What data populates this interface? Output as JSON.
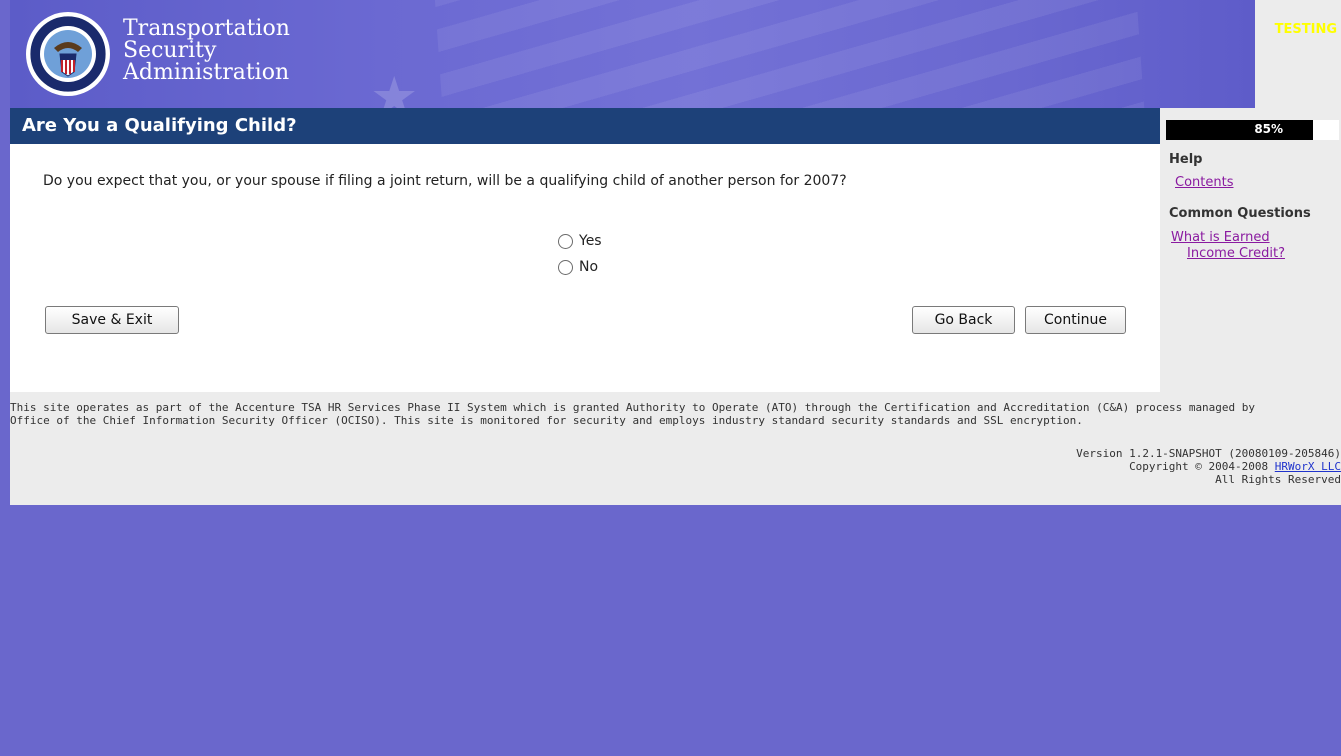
{
  "header": {
    "agency_line1": "Transportation",
    "agency_line2": "Security",
    "agency_line3": "Administration",
    "testing_label": "TESTING"
  },
  "title_bar": {
    "title": "Are You a Qualifying Child?",
    "progress_percent": 85,
    "progress_label": "85%"
  },
  "question": {
    "text": "Do you expect that you, or your spouse if filing a joint return, will be a qualifying child of another person for 2007?",
    "options": [
      "Yes",
      "No"
    ],
    "selected": null
  },
  "buttons": {
    "save_exit": "Save & Exit",
    "go_back": "Go Back",
    "continue": "Continue"
  },
  "help": {
    "heading": "Help",
    "contents_link": "Contents",
    "common_questions_heading": "Common Questions",
    "faq_link_line1": "What is Earned",
    "faq_link_line2": "Income Credit?"
  },
  "footer": {
    "note_line1": "This site operates as part of the Accenture TSA HR Services Phase II System which is granted Authority to Operate (ATO) through the Certification and Accreditation (C&A) process managed by",
    "note_line2": "Office of the Chief Information Security Officer (OCISO). This site is monitored for security and employs industry standard security standards and SSL encryption.",
    "version": "Version 1.2.1-SNAPSHOT (20080109-205846)",
    "copyright_prefix": "Copyright © 2004-2008 ",
    "copyright_link": "HRWorX LLC",
    "rights": "All Rights Reserved"
  },
  "colors": {
    "page_background": "#6a67cc",
    "title_bar": "#1d4179",
    "link": "#8a1aa0",
    "testing": "#ffff00"
  }
}
